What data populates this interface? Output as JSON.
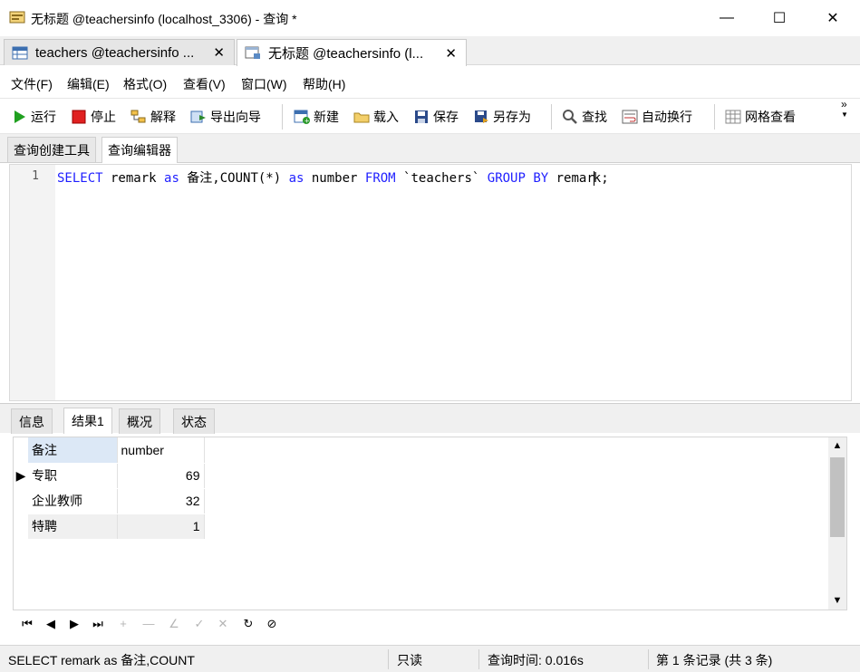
{
  "window": {
    "title": "无标题 @teachersinfo (localhost_3306) - 查询 *",
    "minimize_glyph": "—",
    "maximize_glyph": "☐",
    "close_glyph": "✕"
  },
  "doc_tabs": [
    {
      "label": "teachers @teachersinfo ...",
      "close": "✕"
    },
    {
      "label": "无标题 @teachersinfo (l...",
      "close": "✕"
    }
  ],
  "menu": [
    "文件(F)",
    "编辑(E)",
    "格式(O)",
    "查看(V)",
    "窗口(W)",
    "帮助(H)"
  ],
  "toolbar": {
    "run": "运行",
    "stop": "停止",
    "explain": "解释",
    "export_wizard": "导出向导",
    "new": "新建",
    "load": "载入",
    "save": "保存",
    "save_as": "另存为",
    "find": "查找",
    "word_wrap": "自动换行",
    "grid_view": "网格查看",
    "more": "»"
  },
  "editor_tabs": [
    "查询创建工具",
    "查询编辑器"
  ],
  "editor": {
    "line_number": "1",
    "tokens": {
      "t1": "SELECT",
      "t2": " remark ",
      "t3": "as",
      "t4": " 备注,COUNT(*) ",
      "t5": "as",
      "t6": " number ",
      "t7": "FROM",
      "t8": " `teachers` ",
      "t9": "GROUP BY",
      "t10": " remar",
      "t11": "k;"
    }
  },
  "result_tabs": [
    "信息",
    "结果1",
    "概况",
    "状态"
  ],
  "grid": {
    "columns": [
      "备注",
      "number"
    ],
    "rows": [
      {
        "remark": "专职",
        "number": "69"
      },
      {
        "remark": "企业教师",
        "number": "32"
      },
      {
        "remark": "特聘",
        "number": "1"
      }
    ],
    "current_row_marker": "▶"
  },
  "nav": {
    "first": "⏮",
    "prev": "◀",
    "next": "▶",
    "last": "⏭",
    "add": "+",
    "delete": "—",
    "edit": "∠",
    "apply": "✓",
    "cancel": "✕",
    "refresh": "↻",
    "stop": "⊘"
  },
  "status": {
    "sql": "SELECT remark as 备注,COUNT",
    "mode": "只读",
    "query_time": "查询时间: 0.016s",
    "record": "第 1 条记录 (共 3 条)"
  },
  "colors": {
    "keyword": "#1f1fff",
    "header_selected": "#dce8f6",
    "run_green": "#20a020",
    "stop_red": "#e02020"
  }
}
